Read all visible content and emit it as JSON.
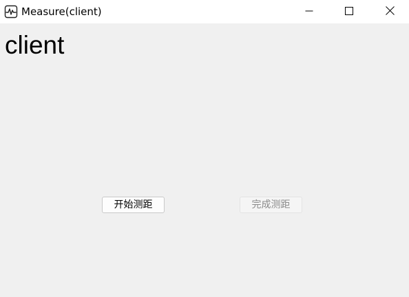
{
  "window": {
    "title": "Measure(client)",
    "app_icon": "waveform-icon"
  },
  "title_controls": {
    "minimize_icon": "minimize-icon",
    "maximize_icon": "maximize-icon",
    "close_icon": "close-icon"
  },
  "main": {
    "heading": "client",
    "start_button_label": "开始测距",
    "finish_button_label": "完成测距",
    "finish_button_enabled": false
  }
}
